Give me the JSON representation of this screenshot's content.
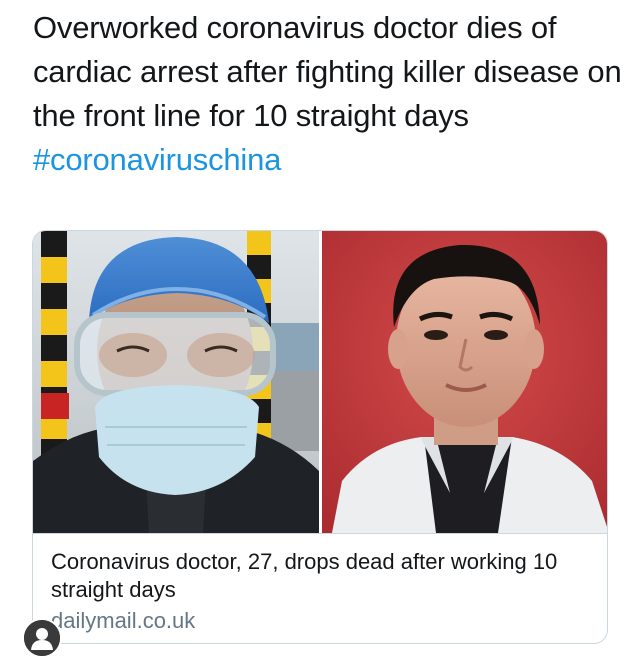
{
  "tweet": {
    "text": "Overworked coronavirus doctor dies of cardiac arrest after fighting killer disease on the front line for 10 straight days ",
    "hashtag": "#coronaviruschina"
  },
  "card": {
    "title": "Coronavirus doctor, 27, drops dead after working 10 straight days",
    "domain": "dailymail.co.uk",
    "left_image": "doctor-in-mask-and-goggles-photo",
    "right_image": "doctor-portrait-photo"
  },
  "user": {
    "avatar_icon": "default-user-icon"
  },
  "colors": {
    "text": "#14171a",
    "hashtag": "#1b95e0",
    "domain": "#657786",
    "border": "#ccd6dd"
  }
}
